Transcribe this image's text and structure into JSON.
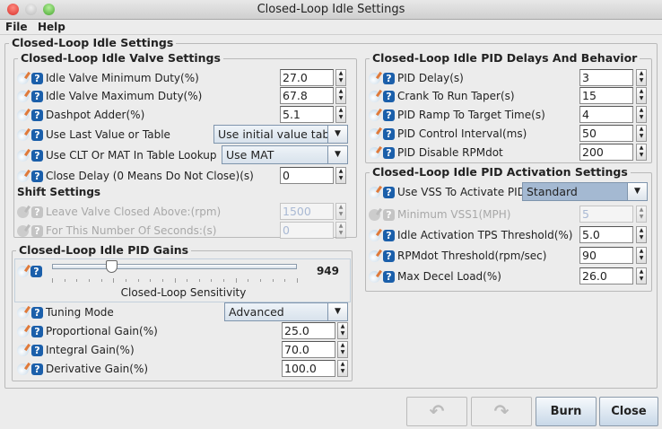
{
  "window": {
    "title": "Closed-Loop Idle Settings"
  },
  "menu": {
    "file": "File",
    "help": "Help"
  },
  "main": {
    "title": "Closed-Loop Idle Settings"
  },
  "valve": {
    "title": "Closed-Loop Idle Valve Settings",
    "shift_title": "Shift Settings",
    "rows": [
      {
        "label": "Idle Valve Minimum Duty(%)",
        "type": "num",
        "value": "27.0"
      },
      {
        "label": "Idle Valve Maximum Duty(%)",
        "type": "num",
        "value": "67.8"
      },
      {
        "label": "Dashpot Adder(%)",
        "type": "num",
        "value": "5.1"
      },
      {
        "label": "Use Last Value or Table",
        "type": "combo",
        "value": "Use initial value table"
      },
      {
        "label": "Use CLT Or MAT In Table Lookup",
        "type": "combo",
        "value": "Use MAT"
      },
      {
        "label": "Close Delay (0 Means Do Not Close)(s)",
        "type": "num",
        "value": "0"
      },
      {
        "label": "Leave Valve Closed Above:(rpm)",
        "type": "num",
        "value": "1500",
        "disabled": true
      },
      {
        "label": "For This Number Of Seconds:(s)",
        "type": "num",
        "value": "0",
        "disabled": true
      }
    ]
  },
  "gains": {
    "title": "Closed-Loop Idle PID Gains",
    "slider_label": "Closed-Loop Sensitivity",
    "slider_value": "949",
    "slider_fraction": 0.24,
    "rows": [
      {
        "label": "Tuning Mode",
        "type": "combo",
        "value": "Advanced"
      },
      {
        "label": "Proportional Gain(%)",
        "type": "num",
        "value": "25.0"
      },
      {
        "label": "Integral Gain(%)",
        "type": "num",
        "value": "70.0"
      },
      {
        "label": "Derivative Gain(%)",
        "type": "num",
        "value": "100.0"
      }
    ]
  },
  "delays": {
    "title": "Closed-Loop Idle PID Delays And Behavior",
    "rows": [
      {
        "label": "PID Delay(s)",
        "type": "num",
        "value": "3"
      },
      {
        "label": "Crank To Run Taper(s)",
        "type": "num",
        "value": "15"
      },
      {
        "label": "PID Ramp To Target Time(s)",
        "type": "num",
        "value": "4"
      },
      {
        "label": "PID Control Interval(ms)",
        "type": "num",
        "value": "50"
      },
      {
        "label": "PID Disable RPMdot",
        "type": "num",
        "value": "200"
      }
    ]
  },
  "activation": {
    "title": "Closed-Loop Idle PID Activation Settings",
    "rows": [
      {
        "label": "Use VSS To Activate PID",
        "type": "combo",
        "value": "Standard",
        "selected": true
      },
      {
        "label": "Minimum VSS1(MPH)",
        "type": "num",
        "value": "5",
        "disabled": true
      },
      {
        "label": "Idle Activation TPS Threshold(%)",
        "type": "num",
        "value": "5.0"
      },
      {
        "label": "RPMdot Threshold(rpm/sec)",
        "type": "num",
        "value": "90"
      },
      {
        "label": "Max Decel Load(%)",
        "type": "num",
        "value": "26.0"
      }
    ]
  },
  "buttons": {
    "undo": "↶",
    "redo": "↷",
    "burn": "Burn",
    "close": "Close"
  }
}
